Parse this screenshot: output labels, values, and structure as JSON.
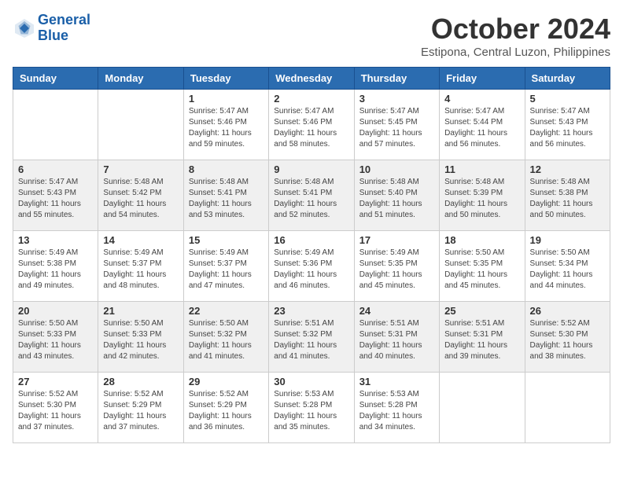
{
  "header": {
    "logo_line1": "General",
    "logo_line2": "Blue",
    "month": "October 2024",
    "location": "Estipona, Central Luzon, Philippines"
  },
  "weekdays": [
    "Sunday",
    "Monday",
    "Tuesday",
    "Wednesday",
    "Thursday",
    "Friday",
    "Saturday"
  ],
  "weeks": [
    [
      {
        "day": "",
        "info": ""
      },
      {
        "day": "",
        "info": ""
      },
      {
        "day": "1",
        "info": "Sunrise: 5:47 AM\nSunset: 5:46 PM\nDaylight: 11 hours and 59 minutes."
      },
      {
        "day": "2",
        "info": "Sunrise: 5:47 AM\nSunset: 5:46 PM\nDaylight: 11 hours and 58 minutes."
      },
      {
        "day": "3",
        "info": "Sunrise: 5:47 AM\nSunset: 5:45 PM\nDaylight: 11 hours and 57 minutes."
      },
      {
        "day": "4",
        "info": "Sunrise: 5:47 AM\nSunset: 5:44 PM\nDaylight: 11 hours and 56 minutes."
      },
      {
        "day": "5",
        "info": "Sunrise: 5:47 AM\nSunset: 5:43 PM\nDaylight: 11 hours and 56 minutes."
      }
    ],
    [
      {
        "day": "6",
        "info": "Sunrise: 5:47 AM\nSunset: 5:43 PM\nDaylight: 11 hours and 55 minutes."
      },
      {
        "day": "7",
        "info": "Sunrise: 5:48 AM\nSunset: 5:42 PM\nDaylight: 11 hours and 54 minutes."
      },
      {
        "day": "8",
        "info": "Sunrise: 5:48 AM\nSunset: 5:41 PM\nDaylight: 11 hours and 53 minutes."
      },
      {
        "day": "9",
        "info": "Sunrise: 5:48 AM\nSunset: 5:41 PM\nDaylight: 11 hours and 52 minutes."
      },
      {
        "day": "10",
        "info": "Sunrise: 5:48 AM\nSunset: 5:40 PM\nDaylight: 11 hours and 51 minutes."
      },
      {
        "day": "11",
        "info": "Sunrise: 5:48 AM\nSunset: 5:39 PM\nDaylight: 11 hours and 50 minutes."
      },
      {
        "day": "12",
        "info": "Sunrise: 5:48 AM\nSunset: 5:38 PM\nDaylight: 11 hours and 50 minutes."
      }
    ],
    [
      {
        "day": "13",
        "info": "Sunrise: 5:49 AM\nSunset: 5:38 PM\nDaylight: 11 hours and 49 minutes."
      },
      {
        "day": "14",
        "info": "Sunrise: 5:49 AM\nSunset: 5:37 PM\nDaylight: 11 hours and 48 minutes."
      },
      {
        "day": "15",
        "info": "Sunrise: 5:49 AM\nSunset: 5:37 PM\nDaylight: 11 hours and 47 minutes."
      },
      {
        "day": "16",
        "info": "Sunrise: 5:49 AM\nSunset: 5:36 PM\nDaylight: 11 hours and 46 minutes."
      },
      {
        "day": "17",
        "info": "Sunrise: 5:49 AM\nSunset: 5:35 PM\nDaylight: 11 hours and 45 minutes."
      },
      {
        "day": "18",
        "info": "Sunrise: 5:50 AM\nSunset: 5:35 PM\nDaylight: 11 hours and 45 minutes."
      },
      {
        "day": "19",
        "info": "Sunrise: 5:50 AM\nSunset: 5:34 PM\nDaylight: 11 hours and 44 minutes."
      }
    ],
    [
      {
        "day": "20",
        "info": "Sunrise: 5:50 AM\nSunset: 5:33 PM\nDaylight: 11 hours and 43 minutes."
      },
      {
        "day": "21",
        "info": "Sunrise: 5:50 AM\nSunset: 5:33 PM\nDaylight: 11 hours and 42 minutes."
      },
      {
        "day": "22",
        "info": "Sunrise: 5:50 AM\nSunset: 5:32 PM\nDaylight: 11 hours and 41 minutes."
      },
      {
        "day": "23",
        "info": "Sunrise: 5:51 AM\nSunset: 5:32 PM\nDaylight: 11 hours and 41 minutes."
      },
      {
        "day": "24",
        "info": "Sunrise: 5:51 AM\nSunset: 5:31 PM\nDaylight: 11 hours and 40 minutes."
      },
      {
        "day": "25",
        "info": "Sunrise: 5:51 AM\nSunset: 5:31 PM\nDaylight: 11 hours and 39 minutes."
      },
      {
        "day": "26",
        "info": "Sunrise: 5:52 AM\nSunset: 5:30 PM\nDaylight: 11 hours and 38 minutes."
      }
    ],
    [
      {
        "day": "27",
        "info": "Sunrise: 5:52 AM\nSunset: 5:30 PM\nDaylight: 11 hours and 37 minutes."
      },
      {
        "day": "28",
        "info": "Sunrise: 5:52 AM\nSunset: 5:29 PM\nDaylight: 11 hours and 37 minutes."
      },
      {
        "day": "29",
        "info": "Sunrise: 5:52 AM\nSunset: 5:29 PM\nDaylight: 11 hours and 36 minutes."
      },
      {
        "day": "30",
        "info": "Sunrise: 5:53 AM\nSunset: 5:28 PM\nDaylight: 11 hours and 35 minutes."
      },
      {
        "day": "31",
        "info": "Sunrise: 5:53 AM\nSunset: 5:28 PM\nDaylight: 11 hours and 34 minutes."
      },
      {
        "day": "",
        "info": ""
      },
      {
        "day": "",
        "info": ""
      }
    ]
  ]
}
